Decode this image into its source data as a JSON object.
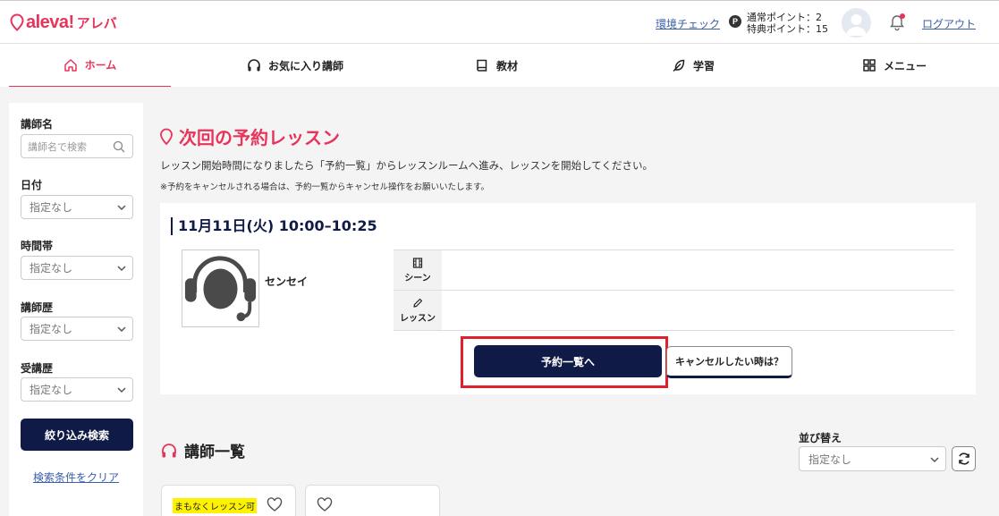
{
  "header": {
    "logo_text": "aleva!",
    "logo_kana": "アレバ",
    "env_check": "環境チェック",
    "points_icon": "P",
    "normal_points": "通常ポイント：2",
    "bonus_points": "特典ポイント：15",
    "logout": "ログアウト"
  },
  "nav": {
    "home": "ホーム",
    "favorites": "お気に入り講師",
    "materials": "教材",
    "study": "学習",
    "menu": "メニュー"
  },
  "sidebar": {
    "teacher_name_label": "講師名",
    "teacher_name_placeholder": "講師名で検索",
    "date_label": "日付",
    "date_value": "指定なし",
    "time_label": "時間帯",
    "time_value": "指定なし",
    "career_label": "講師歴",
    "career_value": "指定なし",
    "history_label": "受講歴",
    "history_value": "指定なし",
    "search_button": "絞り込み検索",
    "clear_link": "検索条件をクリア"
  },
  "main": {
    "next_title": "次回の予約レッスン",
    "desc1": "レッスン開始時間になりましたら「予約一覧」からレッスンルームへ進み、レッスンを開始してください。",
    "desc2": "※予約をキャンセルされる場合は、予約一覧からキャンセル操作をお願いいたします。",
    "lesson": {
      "time": "11月11日(火) 10:00–10:25",
      "teacher_name": "センセイ",
      "scene_label": "シーン",
      "scene_value": "",
      "lesson_label": "レッスン",
      "lesson_value": "",
      "reserve_button": "予約一覧へ",
      "cancel_button": "キャンセルしたい時は？"
    },
    "teachers_title": "講師一覧",
    "sort_label": "並び替え",
    "sort_value": "指定なし",
    "cards": [
      {
        "badge": "まもなくレッスン可"
      },
      {
        "badge": ""
      }
    ]
  },
  "colors": {
    "brand_pink": "#e8335a",
    "navy": "#0f1a46",
    "highlight_red": "#e0202a",
    "link_blue": "#3a5fa8"
  }
}
